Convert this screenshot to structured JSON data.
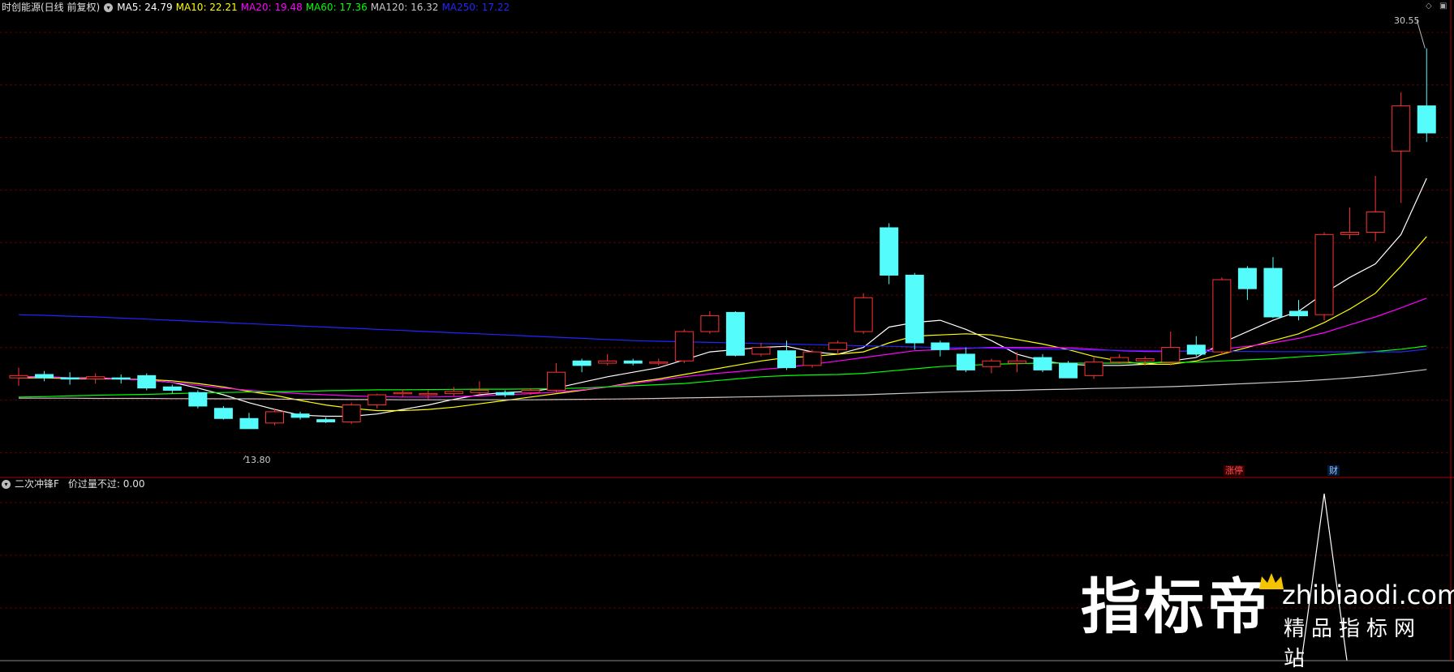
{
  "header": {
    "stock_title": "时创能源(日线 前复权)",
    "mas": [
      {
        "label": "MA5: 24.79",
        "color": "#ffffff"
      },
      {
        "label": "MA10: 22.21",
        "color": "#ffff00"
      },
      {
        "label": "MA20: 19.48",
        "color": "#ff00ff"
      },
      {
        "label": "MA60: 17.36",
        "color": "#00ff00"
      },
      {
        "label": "MA120: 16.32",
        "color": "#c8c8c8"
      },
      {
        "label": "MA250: 17.22",
        "color": "#2424ff"
      }
    ]
  },
  "indicator_panel": {
    "title": "二次冲锋F",
    "value_label": "价过量不过: 0.00"
  },
  "tags": {
    "limit_up": "涨停",
    "finance": "财"
  },
  "watermark": {
    "brand": "指标帝",
    "url": "zhibiaodi.com",
    "slogan": "精品指标网站"
  },
  "chart_data": {
    "type": "candlestick",
    "price_axis": {
      "min": 12.4,
      "max": 31.9
    },
    "labels": {
      "high": "30.55",
      "low": "13.80"
    },
    "colors": {
      "up": "#ff3232",
      "down": "#54fcfc"
    },
    "candles": [
      [
        15.95,
        16.05,
        15.6,
        16.4
      ],
      [
        16.1,
        15.95,
        15.8,
        16.25
      ],
      [
        15.95,
        15.9,
        15.65,
        16.2
      ],
      [
        15.9,
        16.0,
        15.7,
        16.15
      ],
      [
        15.95,
        15.9,
        15.7,
        16.1
      ],
      [
        16.05,
        15.5,
        15.4,
        16.15
      ],
      [
        15.55,
        15.4,
        15.25,
        15.65
      ],
      [
        15.3,
        14.7,
        14.6,
        15.4
      ],
      [
        14.6,
        14.15,
        14.1,
        14.7
      ],
      [
        14.15,
        13.7,
        13.8,
        14.4
      ],
      [
        13.95,
        14.45,
        13.85,
        14.6
      ],
      [
        14.35,
        14.2,
        14.1,
        14.45
      ],
      [
        14.1,
        14.0,
        13.95,
        14.2
      ],
      [
        14.0,
        14.75,
        13.9,
        14.85
      ],
      [
        14.75,
        15.2,
        14.6,
        15.25
      ],
      [
        15.3,
        15.3,
        15.1,
        15.45
      ],
      [
        15.2,
        15.25,
        15.0,
        15.4
      ],
      [
        15.25,
        15.35,
        15.15,
        15.55
      ],
      [
        15.3,
        15.4,
        15.2,
        15.8
      ],
      [
        15.3,
        15.2,
        15.1,
        15.4
      ],
      [
        15.3,
        15.4,
        15.2,
        15.5
      ],
      [
        15.4,
        16.2,
        15.3,
        16.6
      ],
      [
        16.7,
        16.5,
        16.2,
        16.8
      ],
      [
        16.6,
        16.7,
        16.5,
        17.0
      ],
      [
        16.7,
        16.6,
        16.5,
        16.8
      ],
      [
        16.6,
        16.65,
        16.5,
        16.8
      ],
      [
        16.7,
        18.0,
        16.6,
        18.1
      ],
      [
        18.0,
        18.7,
        17.9,
        18.9
      ],
      [
        18.85,
        16.95,
        16.9,
        18.9
      ],
      [
        17.0,
        17.3,
        16.9,
        17.5
      ],
      [
        17.15,
        16.4,
        16.3,
        17.6
      ],
      [
        16.5,
        17.1,
        16.4,
        17.2
      ],
      [
        17.2,
        17.5,
        17.0,
        17.6
      ],
      [
        18.0,
        19.5,
        17.9,
        19.7
      ],
      [
        22.6,
        20.5,
        20.1,
        22.8
      ],
      [
        20.5,
        17.5,
        17.2,
        20.6
      ],
      [
        17.5,
        17.2,
        16.9,
        17.6
      ],
      [
        17.0,
        16.3,
        16.2,
        17.3
      ],
      [
        16.45,
        16.7,
        16.15,
        16.8
      ],
      [
        16.6,
        16.7,
        16.2,
        17.1
      ],
      [
        16.85,
        16.3,
        16.2,
        17.0
      ],
      [
        16.6,
        15.95,
        16.0,
        16.7
      ],
      [
        16.05,
        16.65,
        15.9,
        16.9
      ],
      [
        16.65,
        16.85,
        16.6,
        17.0
      ],
      [
        16.7,
        16.8,
        16.5,
        16.9
      ],
      [
        16.65,
        17.3,
        16.5,
        18.0
      ],
      [
        17.4,
        17.0,
        16.9,
        17.8
      ],
      [
        17.1,
        20.3,
        17.0,
        20.4
      ],
      [
        20.8,
        19.9,
        19.4,
        20.9
      ],
      [
        20.8,
        18.65,
        18.6,
        21.3
      ],
      [
        18.9,
        18.7,
        18.5,
        19.4
      ],
      [
        18.75,
        22.3,
        18.5,
        22.4
      ],
      [
        22.3,
        22.4,
        22.1,
        23.5
      ],
      [
        22.4,
        23.3,
        22.0,
        24.9
      ],
      [
        26.0,
        28.0,
        23.7,
        28.6
      ],
      [
        28.0,
        26.8,
        26.4,
        30.55
      ]
    ],
    "series": [
      {
        "name": "MA5",
        "color": "#ffffff",
        "values": [
          16.0,
          16.0,
          15.95,
          15.95,
          15.9,
          15.85,
          15.75,
          15.5,
          15.2,
          14.85,
          14.55,
          14.3,
          14.25,
          14.25,
          14.35,
          14.55,
          14.75,
          15.0,
          15.2,
          15.3,
          15.35,
          15.5,
          15.75,
          16.0,
          16.2,
          16.4,
          16.75,
          17.1,
          17.2,
          17.3,
          17.35,
          17.1,
          17.0,
          17.3,
          18.2,
          18.4,
          18.5,
          18.1,
          17.6,
          17.0,
          16.7,
          16.55,
          16.5,
          16.5,
          16.55,
          16.7,
          16.85,
          17.5,
          18.0,
          18.5,
          18.9,
          19.7,
          20.4,
          21.0,
          22.3,
          24.79
        ]
      },
      {
        "name": "MA10",
        "color": "#ffff00",
        "values": [
          15.95,
          15.95,
          15.92,
          15.9,
          15.9,
          15.88,
          15.82,
          15.7,
          15.55,
          15.35,
          15.18,
          14.95,
          14.75,
          14.6,
          14.5,
          14.5,
          14.55,
          14.65,
          14.8,
          14.95,
          15.1,
          15.25,
          15.4,
          15.55,
          15.75,
          15.9,
          16.1,
          16.3,
          16.5,
          16.7,
          16.85,
          16.9,
          17.0,
          17.1,
          17.5,
          17.8,
          17.85,
          17.9,
          17.85,
          17.65,
          17.45,
          17.2,
          16.9,
          16.7,
          16.55,
          16.55,
          16.7,
          17.0,
          17.3,
          17.6,
          17.9,
          18.4,
          19.0,
          19.7,
          20.9,
          22.21
        ]
      },
      {
        "name": "MA20",
        "color": "#ff00ff",
        "values": [
          16.0,
          15.98,
          15.95,
          15.93,
          15.9,
          15.85,
          15.75,
          15.62,
          15.5,
          15.4,
          15.32,
          15.25,
          15.2,
          15.15,
          15.12,
          15.1,
          15.1,
          15.12,
          15.15,
          15.2,
          15.25,
          15.32,
          15.42,
          15.55,
          15.7,
          15.85,
          16.0,
          16.12,
          16.22,
          16.32,
          16.42,
          16.55,
          16.7,
          16.85,
          17.0,
          17.15,
          17.2,
          17.25,
          17.3,
          17.3,
          17.3,
          17.28,
          17.22,
          17.15,
          17.12,
          17.12,
          17.15,
          17.22,
          17.35,
          17.5,
          17.7,
          17.95,
          18.3,
          18.65,
          19.05,
          19.48
        ]
      },
      {
        "name": "MA60",
        "color": "#00ff00",
        "values": [
          15.1,
          15.12,
          15.15,
          15.18,
          15.2,
          15.22,
          15.25,
          15.28,
          15.3,
          15.32,
          15.33,
          15.35,
          15.38,
          15.4,
          15.42,
          15.42,
          15.43,
          15.44,
          15.45,
          15.45,
          15.46,
          15.47,
          15.5,
          15.55,
          15.6,
          15.65,
          15.7,
          15.8,
          15.9,
          16.0,
          16.05,
          16.08,
          16.1,
          16.15,
          16.25,
          16.35,
          16.45,
          16.5,
          16.55,
          16.58,
          16.6,
          16.6,
          16.6,
          16.6,
          16.62,
          16.63,
          16.65,
          16.7,
          16.75,
          16.8,
          16.88,
          16.95,
          17.03,
          17.12,
          17.22,
          17.36
        ]
      },
      {
        "name": "MA120",
        "color": "#c8c8c8",
        "values": [
          15.05,
          15.05,
          15.05,
          15.04,
          15.04,
          15.04,
          15.03,
          15.03,
          15.02,
          15.02,
          15.01,
          15.0,
          15.0,
          14.99,
          14.99,
          14.98,
          14.98,
          14.98,
          14.98,
          14.98,
          14.98,
          14.99,
          15.0,
          15.01,
          15.02,
          15.04,
          15.06,
          15.08,
          15.1,
          15.12,
          15.14,
          15.16,
          15.18,
          15.2,
          15.24,
          15.28,
          15.32,
          15.35,
          15.38,
          15.4,
          15.43,
          15.45,
          15.48,
          15.5,
          15.53,
          15.56,
          15.6,
          15.65,
          15.7,
          15.75,
          15.8,
          15.87,
          15.95,
          16.05,
          16.18,
          16.32
        ]
      },
      {
        "name": "MA250",
        "color": "#2424ff",
        "values": [
          18.75,
          18.72,
          18.68,
          18.65,
          18.6,
          18.55,
          18.5,
          18.45,
          18.4,
          18.35,
          18.3,
          18.25,
          18.2,
          18.15,
          18.1,
          18.05,
          18.0,
          17.95,
          17.9,
          17.85,
          17.8,
          17.75,
          17.7,
          17.65,
          17.6,
          17.57,
          17.55,
          17.52,
          17.5,
          17.47,
          17.45,
          17.42,
          17.4,
          17.37,
          17.35,
          17.32,
          17.3,
          17.28,
          17.26,
          17.24,
          17.22,
          17.2,
          17.18,
          17.17,
          17.15,
          17.14,
          17.13,
          17.12,
          17.12,
          17.11,
          17.11,
          17.1,
          17.1,
          17.1,
          17.1,
          17.22
        ]
      }
    ],
    "indicator_values": [
      0,
      0,
      0,
      0,
      0,
      0,
      0,
      0,
      0,
      0,
      0,
      0,
      0,
      0,
      0,
      0,
      0,
      0,
      0,
      0,
      0,
      0,
      0,
      0,
      0,
      0,
      0,
      0,
      0,
      0,
      0,
      0,
      0,
      0,
      0,
      0,
      0,
      0,
      0,
      0,
      0,
      0,
      0,
      0,
      0,
      0,
      0,
      0,
      0,
      0,
      0,
      1,
      0,
      0,
      0,
      0
    ]
  }
}
